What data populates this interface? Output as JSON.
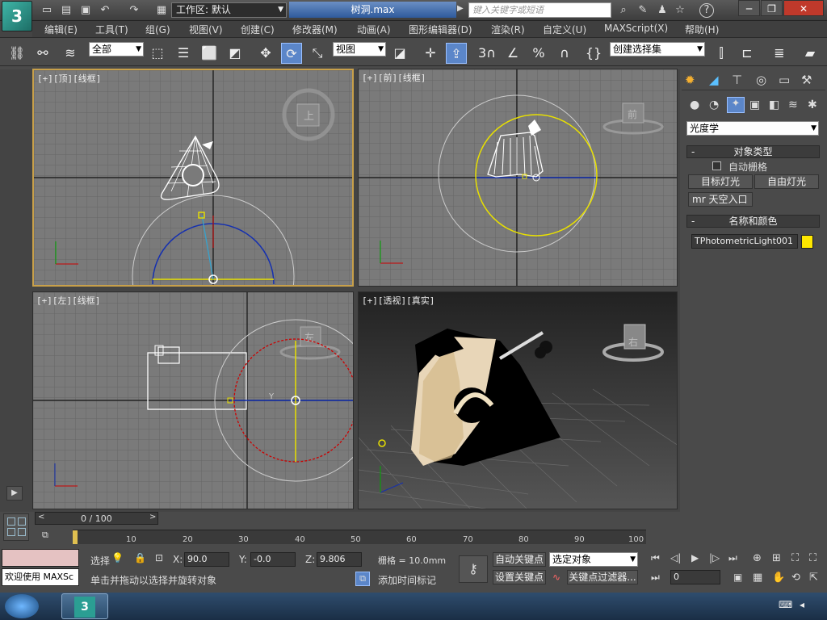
{
  "titlebar": {
    "logo": "3",
    "workspace_label": "工作区: 默认",
    "file_title": "树洞.max",
    "search_placeholder": "键入关键字或短语",
    "help_icon": "?"
  },
  "menu": [
    "编辑(E)",
    "工具(T)",
    "组(G)",
    "视图(V)",
    "创建(C)",
    "修改器(M)",
    "动画(A)",
    "图形编辑器(D)",
    "渲染(R)",
    "自定义(U)",
    "MAXScript(X)",
    "帮助(H)"
  ],
  "toolbar": {
    "selection_filter": "全部",
    "ref_coord": "视图",
    "snap_3": "3",
    "snap_pct": "%",
    "named_selection": "创建选择集"
  },
  "viewports": {
    "top": "[+][顶][线框]",
    "front": "[+][前][线框]",
    "left": "[+][左][线框]",
    "persp": "[+][透视][真实]",
    "cube_top": "上",
    "cube_front": "前",
    "cube_left": "左",
    "cube_persp": "右",
    "axis_y": "Y"
  },
  "command_panel": {
    "category": "光度学",
    "object_type_title": "对象类型",
    "auto_grid": "自动栅格",
    "target_light": "目标灯光",
    "free_light": "自由灯光",
    "mr_sky_portal": "mr 天空入口",
    "name_color_title": "名称和颜色",
    "object_name": "TPhotometricLight001",
    "object_color": "#ffe800"
  },
  "timeline": {
    "frame_display": "0 / 100",
    "ticks": [
      "10",
      "20",
      "30",
      "40",
      "50",
      "60",
      "70",
      "80",
      "90",
      "100"
    ],
    "frame_zero": "0"
  },
  "status": {
    "welcome": "欢迎使用 MAXSc",
    "select_label": "选择",
    "x_label": "X:",
    "x_value": "90.0",
    "y_label": "Y:",
    "y_value": "-0.0",
    "z_label": "Z:",
    "z_value": "9.806",
    "grid": "栅格 = 10.0mm",
    "prompt": "单击并拖动以选择并旋转对象",
    "add_time_tag": "添加时间标记",
    "auto_key": "自动关键点",
    "set_key": "设置关键点",
    "key_mode": "选定对象",
    "key_filters": "关键点过滤器...",
    "current_frame": "0"
  }
}
